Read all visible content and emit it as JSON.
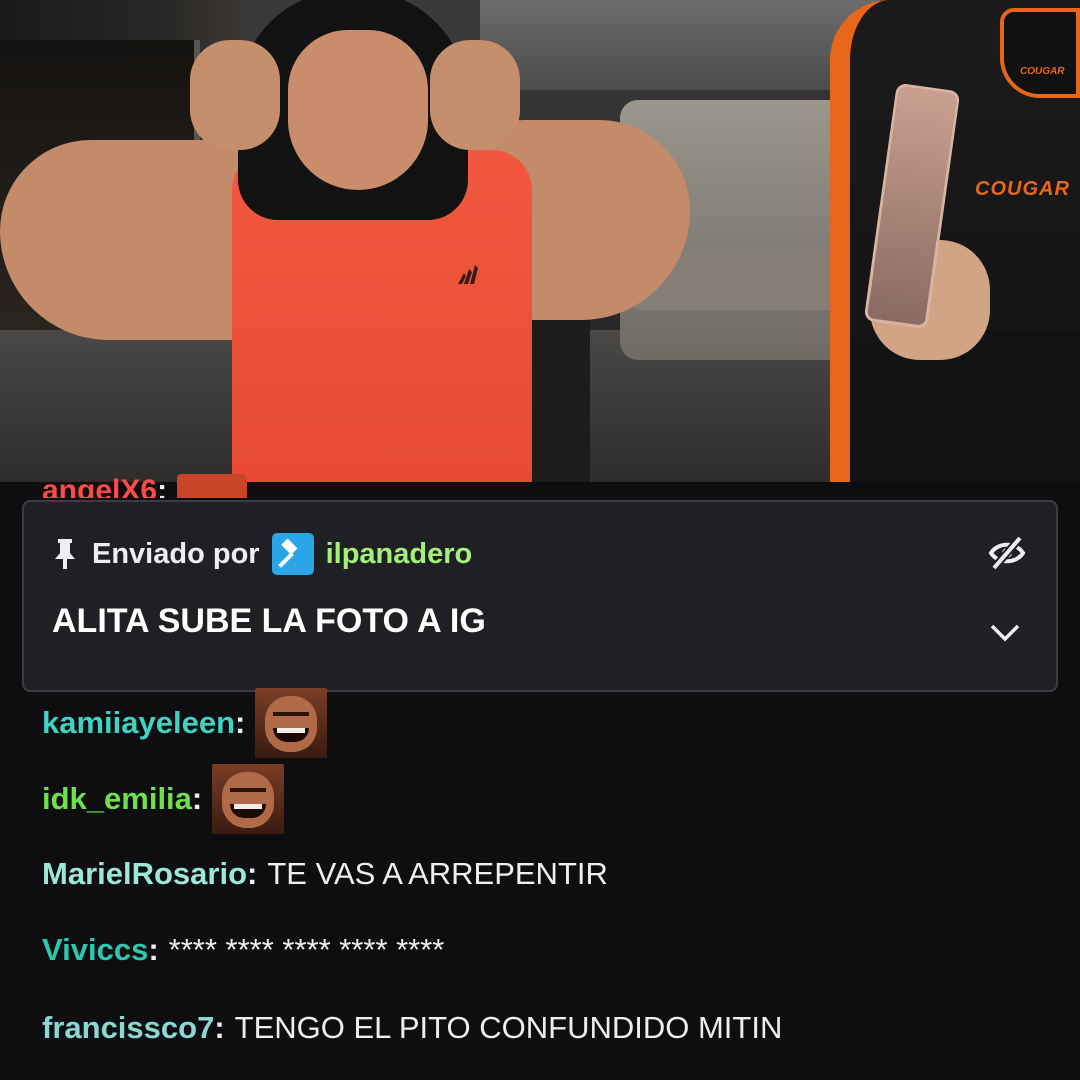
{
  "stream": {
    "chair_brand": "COUGAR",
    "chair_logo_text": "COUGAR"
  },
  "chat": {
    "peek": {
      "user": "angelX6",
      "colon": ":"
    },
    "pinned": {
      "sent_by_label": "Enviado por",
      "user": "ilpanadero",
      "message": "ALITA SUBE LA FOTO A IG",
      "icons": {
        "pin": "pin-icon",
        "badge": "moderator-badge-icon",
        "hide": "eye-slash-icon",
        "expand": "chevron-down-icon"
      }
    },
    "messages": [
      {
        "user": "kamiiayeleen",
        "colon": ":",
        "color": "#3ed3c2",
        "text": "",
        "emote": "laughing-man-emote"
      },
      {
        "user": "idk_emilia",
        "colon": ":",
        "color": "#6fe14c",
        "text": "",
        "emote": "laughing-man-emote"
      },
      {
        "user": "MarielRosario",
        "colon": ":",
        "color": "#9ce8d8",
        "text": "TE VAS A ARREPENTIR",
        "emote": ""
      },
      {
        "user": "Viviccs",
        "colon": ":",
        "color": "#2ec8b0",
        "text": "**** **** **** **** ****",
        "emote": ""
      },
      {
        "user": "francissco7",
        "colon": ":",
        "color": "#8ad8d4",
        "text": "TENGO EL PITO CONFUNDIDO MITIN",
        "emote": ""
      }
    ]
  },
  "colors": {
    "background": "#0e0e10",
    "pinned_bg": "#1f2023",
    "pinned_user": "#a5f07a",
    "mod_badge": "#2aa6e8",
    "peek_user": "#ff4a4a"
  }
}
